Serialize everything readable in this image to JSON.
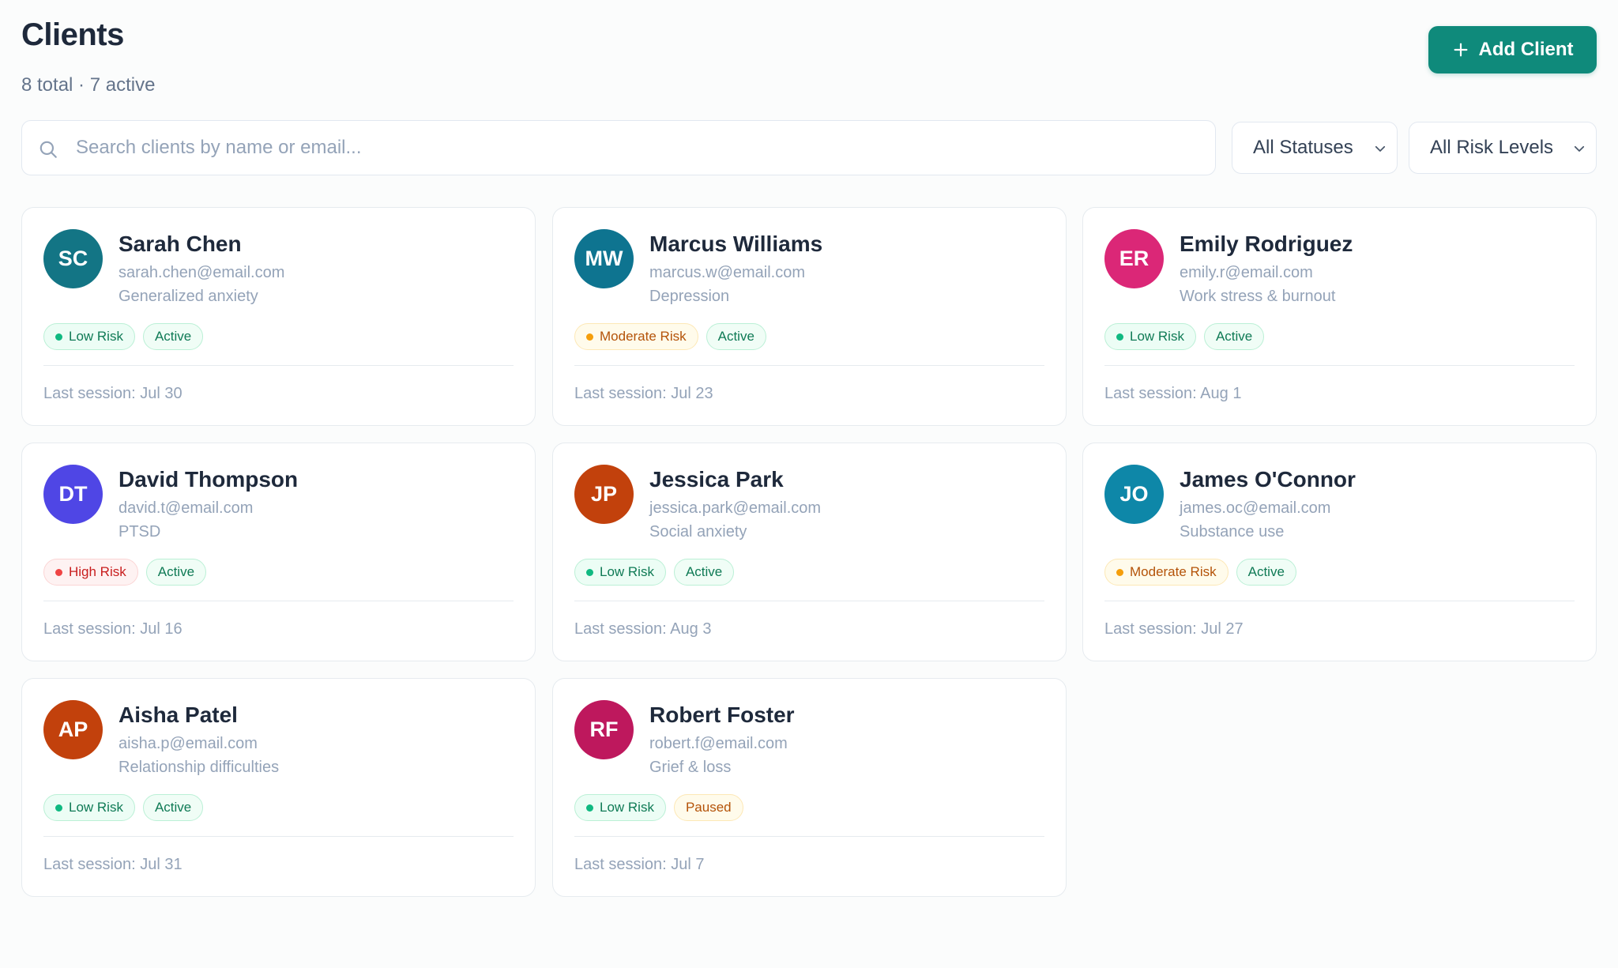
{
  "header": {
    "title": "Clients",
    "subtitle": "8 total · 7 active",
    "add_button_label": "Add Client",
    "add_button_icon": "plus-icon"
  },
  "filters": {
    "search_placeholder": "Search clients by name or email...",
    "search_value": "",
    "search_icon": "search-icon",
    "status_select": {
      "selected": "All Statuses",
      "icon": "chevron-down-icon"
    },
    "risk_select": {
      "selected": "All Risk Levels",
      "icon": "chevron-down-icon"
    }
  },
  "colors": {
    "accent": "#0f8a7b",
    "risk_low": "#10b981",
    "risk_moderate": "#f59e0b",
    "risk_high": "#ef4444"
  },
  "clients": [
    {
      "initials": "SC",
      "avatar_color": "#137585",
      "name": "Sarah Chen",
      "email": "sarah.chen@email.com",
      "concern": "Generalized anxiety",
      "risk": "Low Risk",
      "risk_level": "low",
      "status": "Active",
      "last_session": "Last session: Jul 30"
    },
    {
      "initials": "MW",
      "avatar_color": "#0e7490",
      "name": "Marcus Williams",
      "email": "marcus.w@email.com",
      "concern": "Depression",
      "risk": "Moderate Risk",
      "risk_level": "moderate",
      "status": "Active",
      "last_session": "Last session: Jul 23"
    },
    {
      "initials": "ER",
      "avatar_color": "#db2777",
      "name": "Emily Rodriguez",
      "email": "emily.r@email.com",
      "concern": "Work stress & burnout",
      "risk": "Low Risk",
      "risk_level": "low",
      "status": "Active",
      "last_session": "Last session: Aug 1"
    },
    {
      "initials": "DT",
      "avatar_color": "#4f46e5",
      "name": "David Thompson",
      "email": "david.t@email.com",
      "concern": "PTSD",
      "risk": "High Risk",
      "risk_level": "high",
      "status": "Active",
      "last_session": "Last session: Jul 16"
    },
    {
      "initials": "JP",
      "avatar_color": "#c2410c",
      "name": "Jessica Park",
      "email": "jessica.park@email.com",
      "concern": "Social anxiety",
      "risk": "Low Risk",
      "risk_level": "low",
      "status": "Active",
      "last_session": "Last session: Aug 3"
    },
    {
      "initials": "JO",
      "avatar_color": "#0e87a8",
      "name": "James O'Connor",
      "email": "james.oc@email.com",
      "concern": "Substance use",
      "risk": "Moderate Risk",
      "risk_level": "moderate",
      "status": "Active",
      "last_session": "Last session: Jul 27"
    },
    {
      "initials": "AP",
      "avatar_color": "#c2410c",
      "name": "Aisha Patel",
      "email": "aisha.p@email.com",
      "concern": "Relationship difficulties",
      "risk": "Low Risk",
      "risk_level": "low",
      "status": "Active",
      "last_session": "Last session: Jul 31"
    },
    {
      "initials": "RF",
      "avatar_color": "#be185d",
      "name": "Robert Foster",
      "email": "robert.f@email.com",
      "concern": "Grief & loss",
      "risk": "Low Risk",
      "risk_level": "low",
      "status": "Paused",
      "last_session": "Last session: Jul 7"
    }
  ]
}
